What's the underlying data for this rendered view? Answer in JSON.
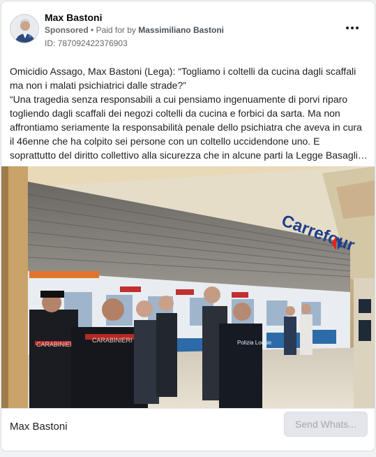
{
  "ad": {
    "page_name": "Max Bastoni",
    "sponsored_label": "Sponsored",
    "separator": "•",
    "paid_for_prefix": "Paid for by",
    "paid_for_name": "Massimiliano Bastoni",
    "id_label": "ID: 787092422376903",
    "more_icon": "more-horizontal-icon",
    "text": {
      "line1": "Omicidio Assago, Max Bastoni (Lega): “Togliamo i coltelli da cucina dagli scaffali ma non i malati psichiatrici dalle strade?”",
      "line2": "“Una tragedia senza responsabili a cui pensiamo ingenuamente di porvi riparo togliendo dagli scaffali dei negozi coltelli da cucina e forbici da sarta. Ma non affrontiamo seriamente la responsabilità penale dello psichiatra che aveva in cura il 46enne che ha colpito sei persone con un coltello uccidendone uno. E soprattutto del diritto collettivo alla sicurezza che in alcune parti la Legge Basagli…"
    },
    "image": {
      "store_sign": "Carrefour",
      "uniform_label_1": "CARABINIERI",
      "uniform_label_2": "CARABINIERI",
      "uniform_label_3": "Polizia Locale"
    },
    "footer": {
      "name": "Max Bastoni",
      "cta_label": "Send Whats..."
    },
    "colors": {
      "link_gray": "#65676b",
      "button_bg": "#e4e6eb",
      "button_text": "#a4a7ab"
    }
  }
}
